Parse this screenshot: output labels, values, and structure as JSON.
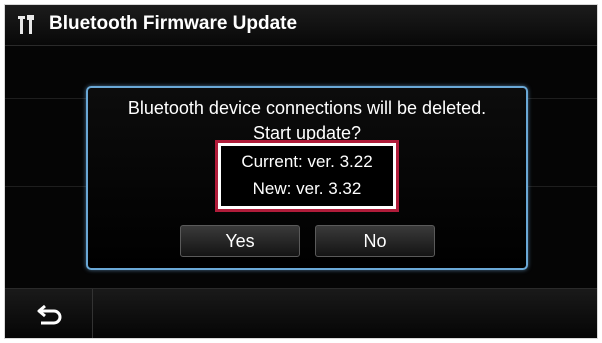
{
  "header": {
    "title": "Bluetooth Firmware Update",
    "icon": "tools-icon"
  },
  "dialog": {
    "message_line1": "Bluetooth device connections will be deleted.",
    "message_line2": "Start update?",
    "current_version": "Current: ver. 3.22",
    "new_version": "New: ver. 3.32",
    "yes_label": "Yes",
    "no_label": "No",
    "highlight_color": "#b01c3a"
  },
  "footer": {
    "back_icon": "back-arrow-icon"
  }
}
